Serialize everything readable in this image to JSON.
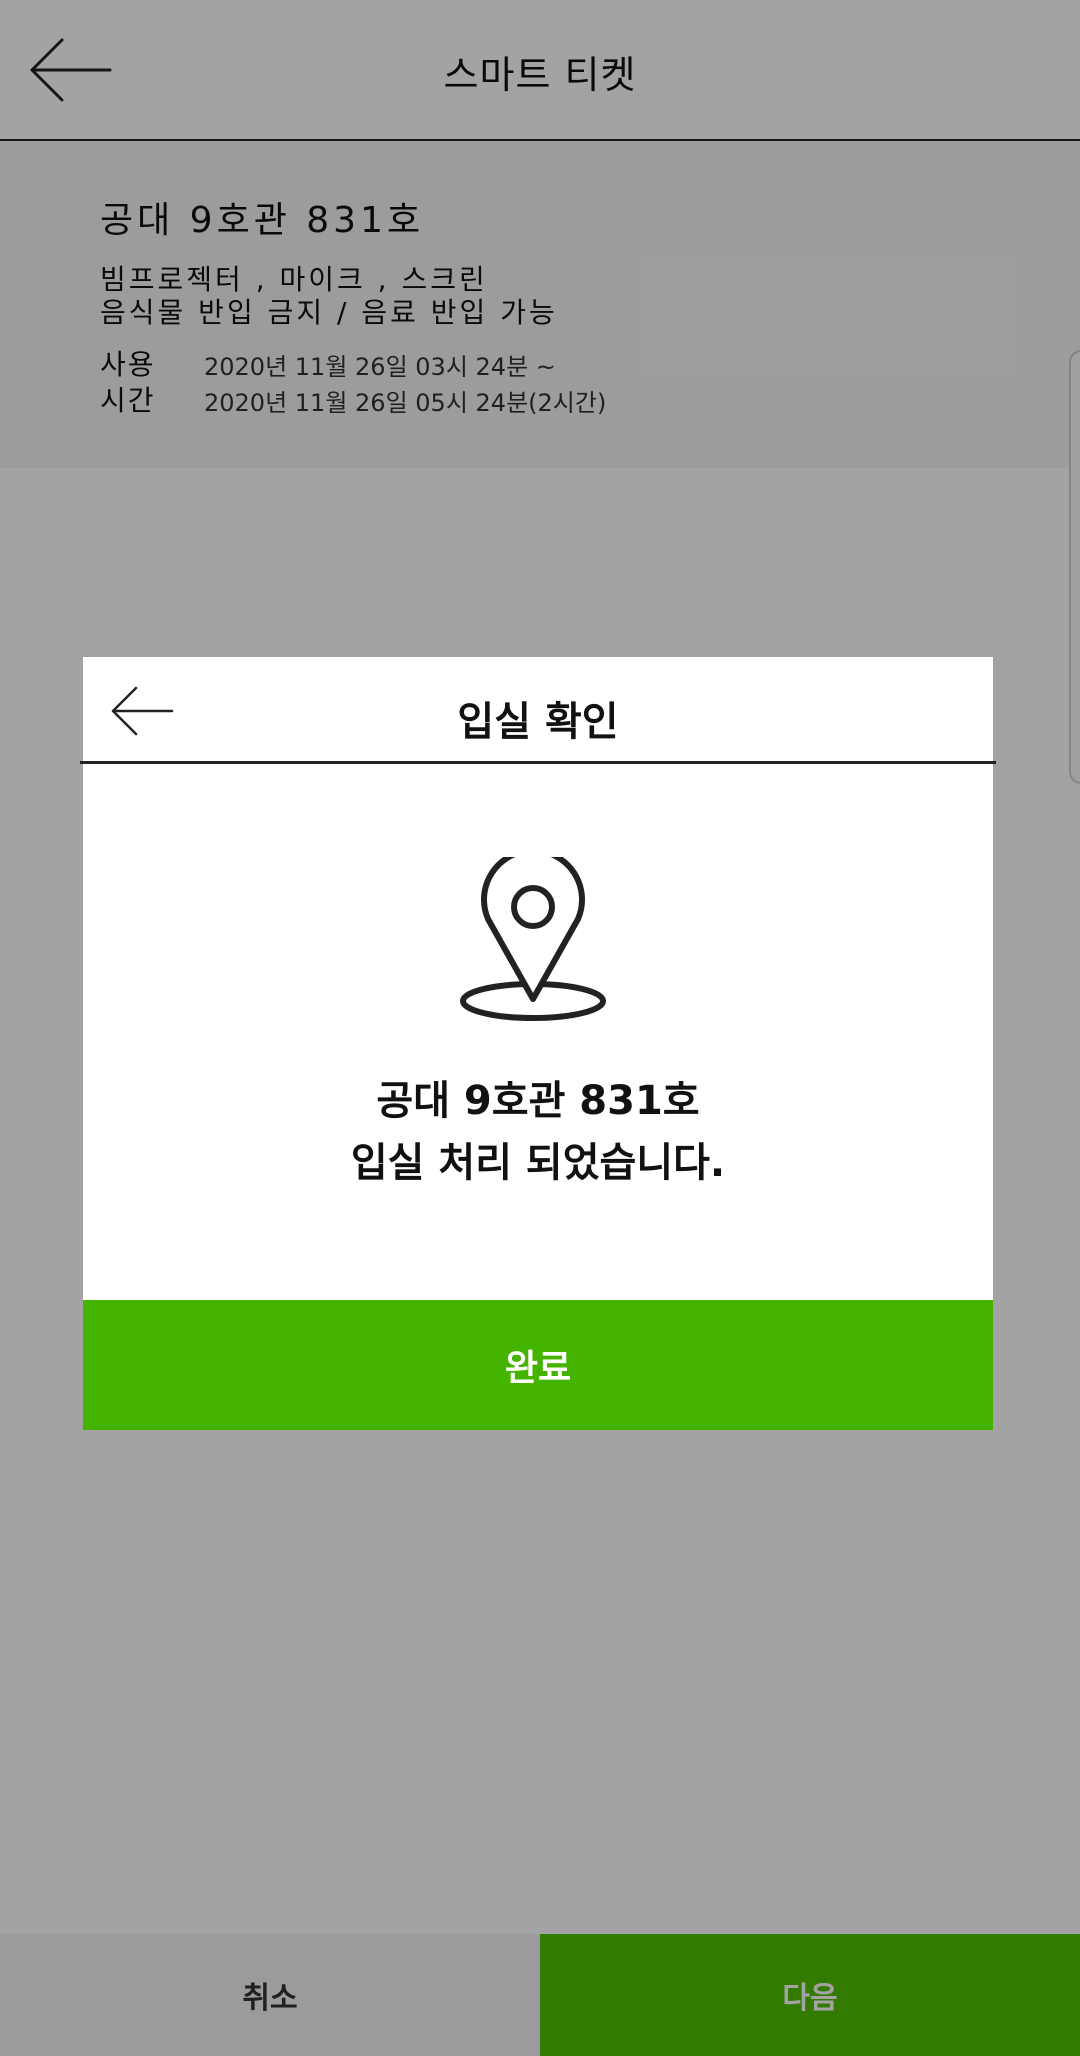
{
  "header": {
    "title": "스마트 티켓"
  },
  "info": {
    "room": "공대 9호관 831호",
    "equipment": "빔프로젝터 , 마이크 , 스크린",
    "rule": "음식물 반입 금지 / 음료 반입 가능",
    "usage_label_1": "사용",
    "usage_label_2": "시간",
    "usage_start": "2020년 11월 26일 03시 24분 ~",
    "usage_end": "2020년 11월 26일 05시 24분(2시간)"
  },
  "modal": {
    "title": "입실 확인",
    "message_line1": "공대 9호관 831호",
    "message_line2": "입실 처리 되었습니다.",
    "confirm_label": "완료",
    "icon": "location-pin-icon"
  },
  "bottom": {
    "cancel_label": "취소",
    "next_label": "다음"
  },
  "colors": {
    "accent_green": "#44b400",
    "next_green": "#4fc000",
    "overlay": "rgba(0,0,0,0.36)"
  }
}
